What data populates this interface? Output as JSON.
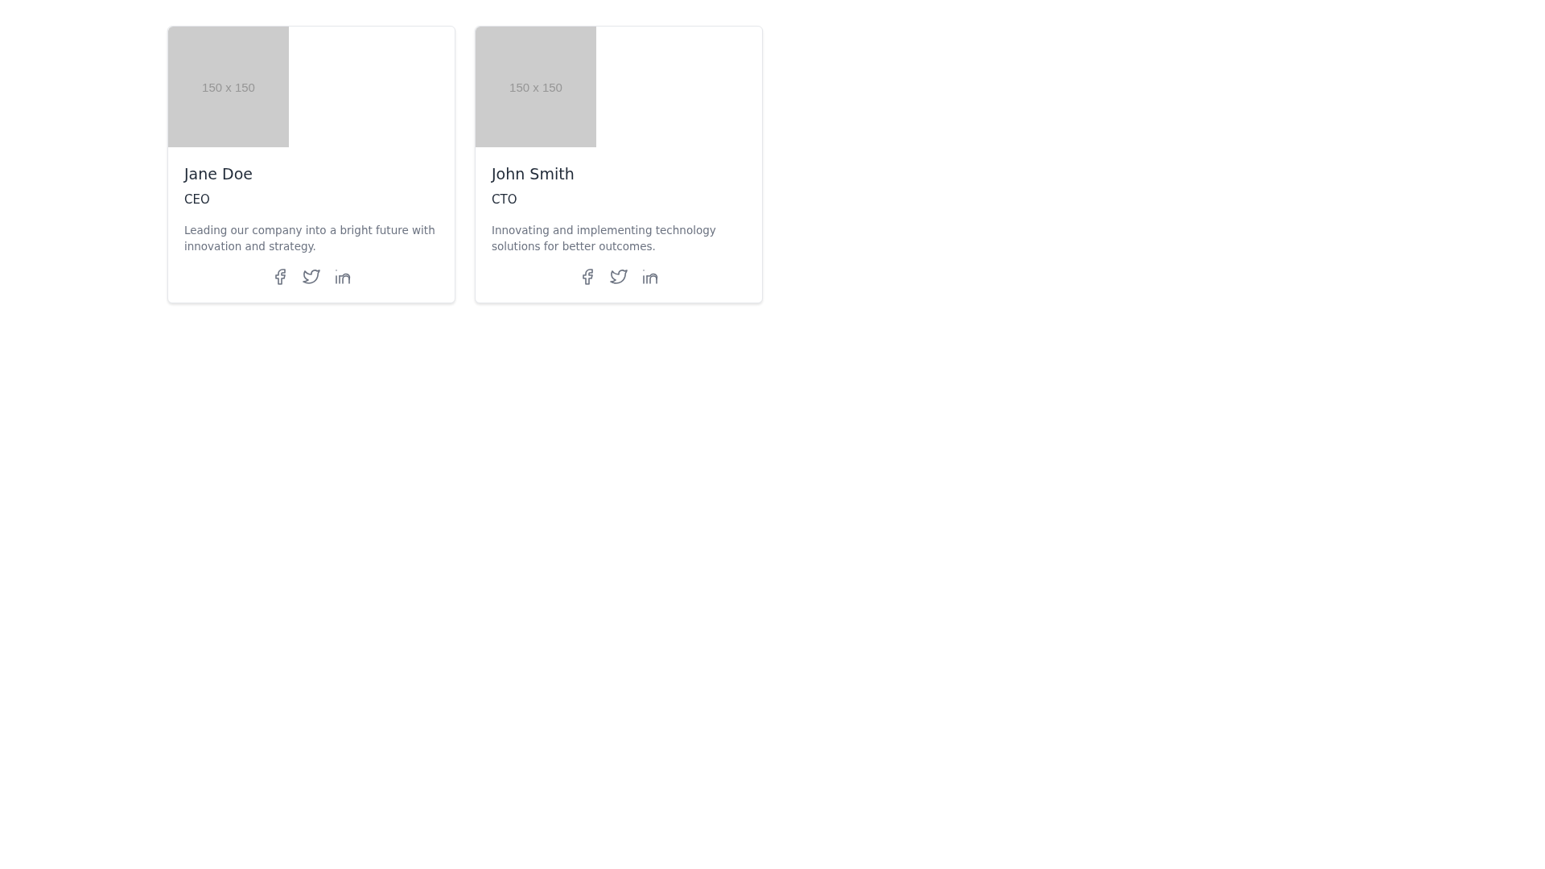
{
  "team": [
    {
      "image_label": "150 x 150",
      "name": "Jane Doe",
      "role": "CEO",
      "bio": "Leading our company into a bright future with innovation and strategy.",
      "socials": [
        {
          "kind": "facebook"
        },
        {
          "kind": "twitter"
        },
        {
          "kind": "linkedin"
        }
      ]
    },
    {
      "image_label": "150 x 150",
      "name": "John Smith",
      "role": "CTO",
      "bio": "Innovating and implementing technology solutions for better outcomes.",
      "socials": [
        {
          "kind": "facebook"
        },
        {
          "kind": "twitter"
        },
        {
          "kind": "linkedin"
        }
      ]
    }
  ]
}
